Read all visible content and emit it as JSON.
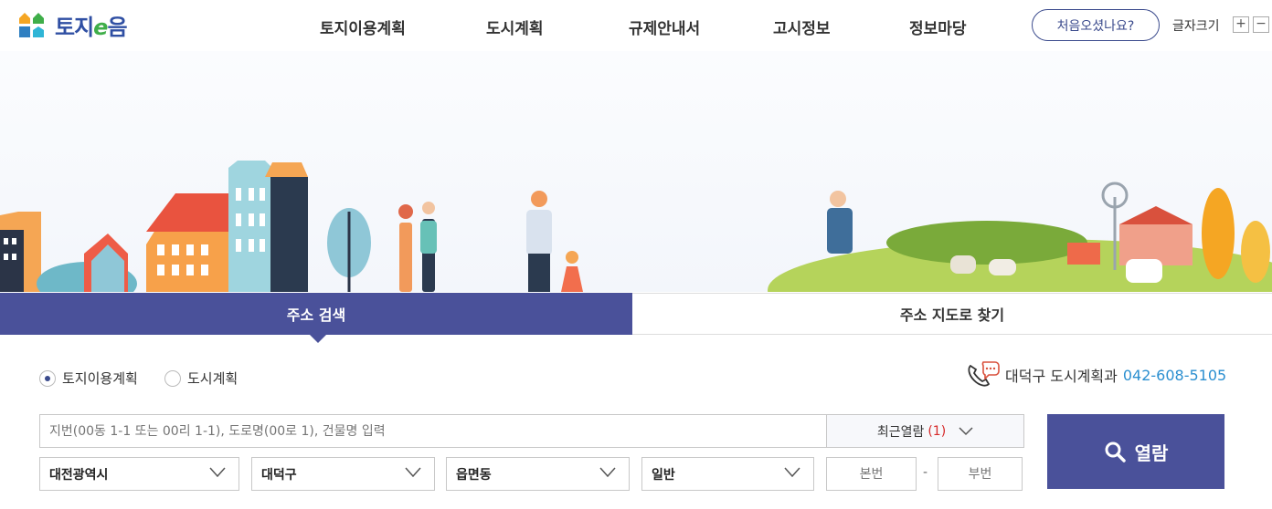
{
  "header": {
    "logo_text_prefix": "토지",
    "logo_text_e": "e",
    "logo_text_suffix": "음",
    "nav": [
      "토지이용계획",
      "도시계획",
      "규제안내서",
      "고시정보",
      "정보마당"
    ],
    "intro_button": "처음오셨나요?",
    "font_size_label": "글자크기",
    "font_plus": "+",
    "font_minus": "−"
  },
  "tabs": {
    "address_search": "주소 검색",
    "map_search": "주소 지도로 찾기"
  },
  "search": {
    "radio_land": "토지이용계획",
    "radio_city": "도시계획",
    "contact_label": "대덕구 도시계획과",
    "contact_phone": "042-608-5105",
    "placeholder": "지번(00동 1-1 또는 00리 1-1), 도로명(00로 1), 건물명 입력",
    "recent_label": "최근열람",
    "recent_count": "(1)",
    "view_button": "열람",
    "select_city": "대전광역시",
    "select_district": "대덕구",
    "select_town": "읍면동",
    "select_type": "일반",
    "main_number_placeholder": "본번",
    "sub_number_placeholder": "부번",
    "dash": "-"
  },
  "colors": {
    "primary": "#4a519a",
    "phone": "#2b8fd0",
    "count": "#d62a2a"
  }
}
